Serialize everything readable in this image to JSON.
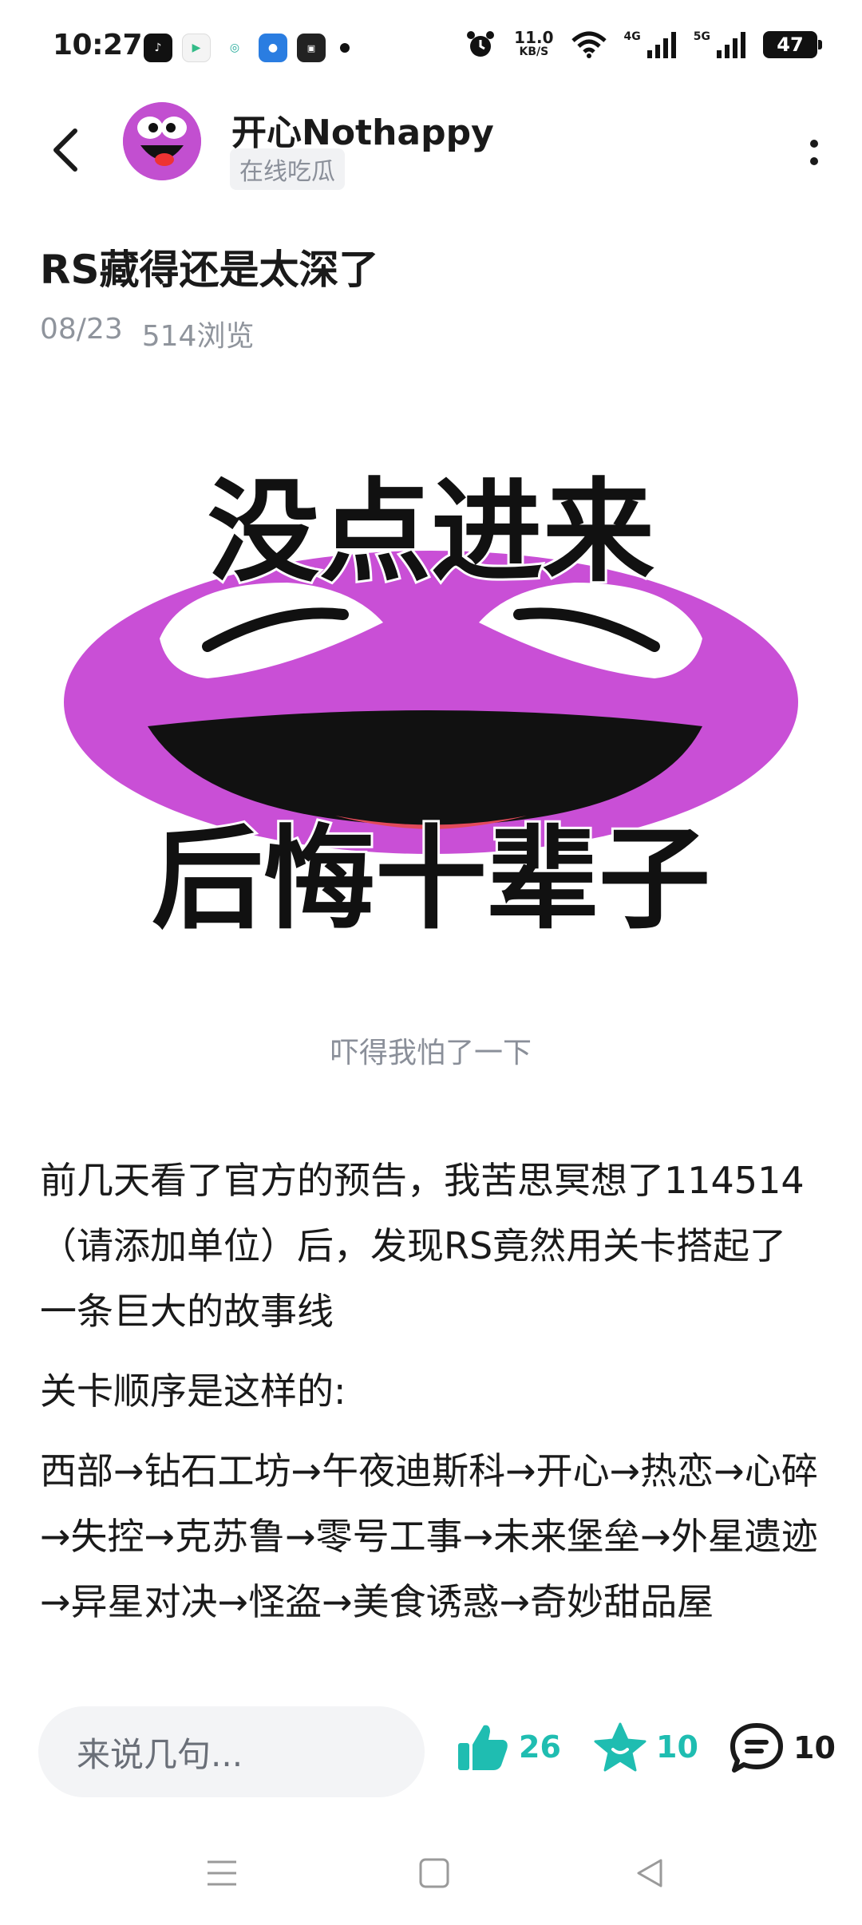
{
  "status_bar": {
    "time": "10:27",
    "net_speed_value": "11.0",
    "net_speed_unit": "KB/S",
    "label_4g": "4G",
    "label_5g": "5G",
    "battery": "47",
    "app_icons": [
      "tiktok-icon",
      "app-icon",
      "app-icon",
      "app-icon",
      "app-icon"
    ]
  },
  "header": {
    "author_name": "开心Nothappy",
    "author_tag": "在线吃瓜"
  },
  "post": {
    "title": "RS藏得还是太深了",
    "date": "08/23",
    "views": "514浏览",
    "meme_text_top": "没点进来",
    "meme_text_bottom": "后悔十辈子",
    "caption": "吓得我怕了一下",
    "paragraphs": [
      "前几天看了官方的预告，我苦思冥想了114514（请添加单位）后，发现RS竟然用关卡搭起了一条巨大的故事线",
      "关卡顺序是这样的:",
      "西部→钻石工坊→午夜迪斯科→开心→热恋→心碎→失控→克苏鲁→零号工事→未来堡垒→外星遗迹→异星对决→怪盗→美食诱惑→奇妙甜品屋"
    ]
  },
  "action_bar": {
    "comment_placeholder": "来说几句...",
    "like_count": "26",
    "fav_count": "10",
    "comment_count": "10"
  },
  "colors": {
    "accent": "#1fbdb1",
    "avatar_bg": "#c24fd0",
    "meme_purple": "#c94fd6"
  }
}
